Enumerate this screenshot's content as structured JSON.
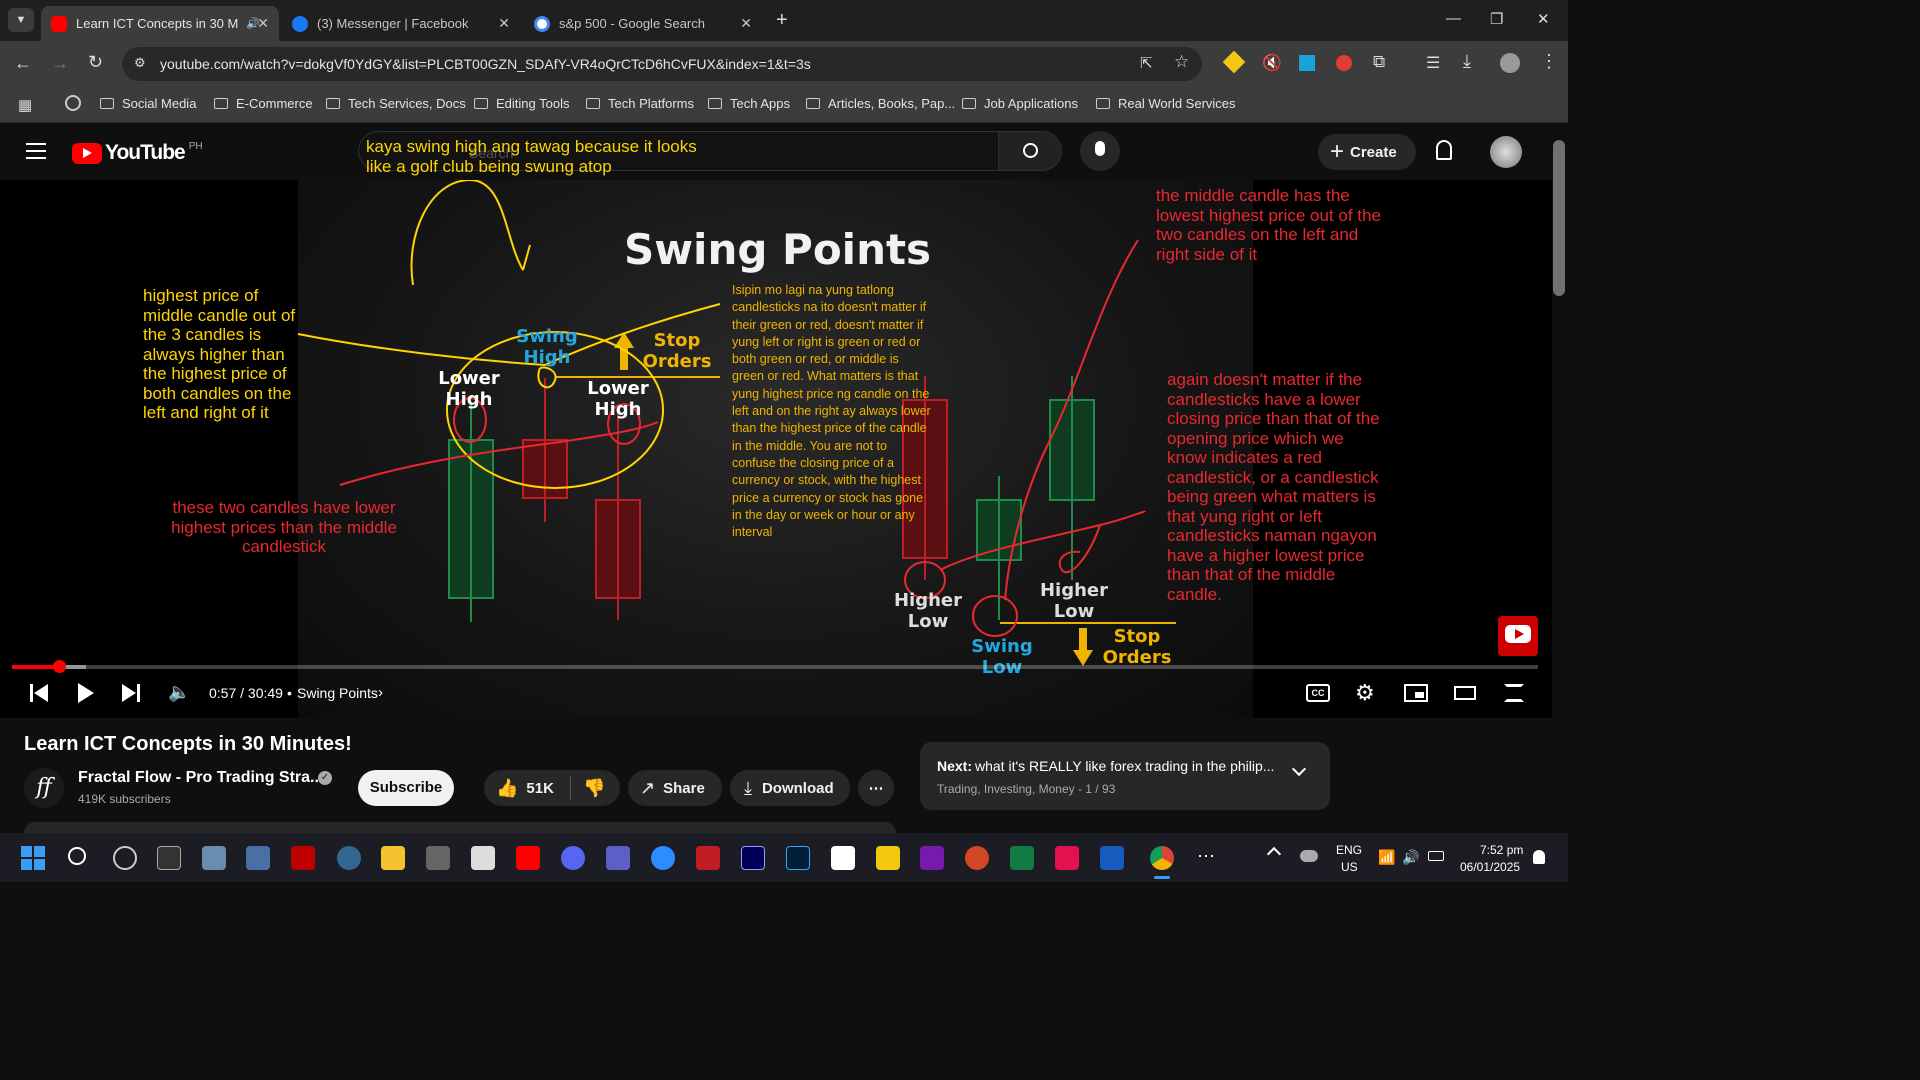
{
  "browser": {
    "tabs": [
      {
        "title": "Learn ICT Concepts in 30 M",
        "favicon": "youtube-icon"
      },
      {
        "title": "(3) Messenger | Facebook",
        "favicon": "facebook-icon"
      },
      {
        "title": "s&p 500 - Google Search",
        "favicon": "google-icon"
      }
    ],
    "url": "youtube.com/watch?v=dokgVf0YdGY&list=PLCBT00GZN_SDAfY-VR4oQrCTcD6hCvFUX&index=1&t=3s",
    "bookmarks": [
      "Social Media",
      "E-Commerce",
      "Tech Services, Docs",
      "Editing Tools",
      "Tech Platforms",
      "Tech Apps",
      "Articles, Books, Pap...",
      "Job Applications",
      "Real World Services"
    ]
  },
  "youtube": {
    "logo": "YouTube",
    "region": "PH",
    "search_placeholder": "Search",
    "create": "Create"
  },
  "slide": {
    "title": "Swing Points",
    "swing_high": "Swing High",
    "lower_high_left": "Lower High",
    "lower_high_right": "Lower High",
    "stop_orders_top": "Stop Orders",
    "stop_orders_bottom": "Stop Orders",
    "higher_low_left": "Higher Low",
    "higher_low_right": "Higher Low",
    "swing_low": "Swing Low",
    "paragraph": "Isipin mo lagi na yung tatlong candlesticks na ito doesn't matter if their green or red, doesn't matter if yung left or right is green or red or both green or red, or middle is green or red. What matters is that yung highest price ng candle on the left and on the right ay always lower than the highest price of the candle in the middle. You are not to confuse the closing price of a currency or stock, with the highest price a currency or stock has gone in the day or week or hour or any interval"
  },
  "annotations": {
    "golf": "kaya swing high ang tawag because it looks like a golf club being swung atop",
    "highest": "highest price of middle candle out of the 3 candles is always higher than the highest price of both candles on the left and right of it",
    "two_candles": "these two candles have lower highest prices than the middle candlestick",
    "middle_candle": "the middle candle has the lowest highest price out of the two candles on the left and right side of it",
    "again": "again doesn't matter if the candlesticks have a lower closing price than that of the opening price which we know indicates a red candlestick, or a candlestick being green what matters is that yung right or left candlesticks naman ngayon have a higher lowest price than that of the middle candle."
  },
  "player": {
    "time": "0:57 / 30:49",
    "chapter": "Swing Points",
    "progress": 0.031
  },
  "video": {
    "title": "Learn ICT Concepts in 30 Minutes!",
    "channel": "Fractal Flow - Pro Trading Stra...",
    "subscribers": "419K subscribers",
    "subscribe": "Subscribe",
    "likes": "51K",
    "share": "Share",
    "download": "Download",
    "next_prefix": "Next:",
    "next_title": "what it's REALLY like forex trading in the philip...",
    "next_meta": "Trading, Investing, Money - 1 / 93"
  },
  "taskbar": {
    "lang": "ENG",
    "region": "US",
    "time": "7:52 pm",
    "date": "06/01/2025"
  }
}
